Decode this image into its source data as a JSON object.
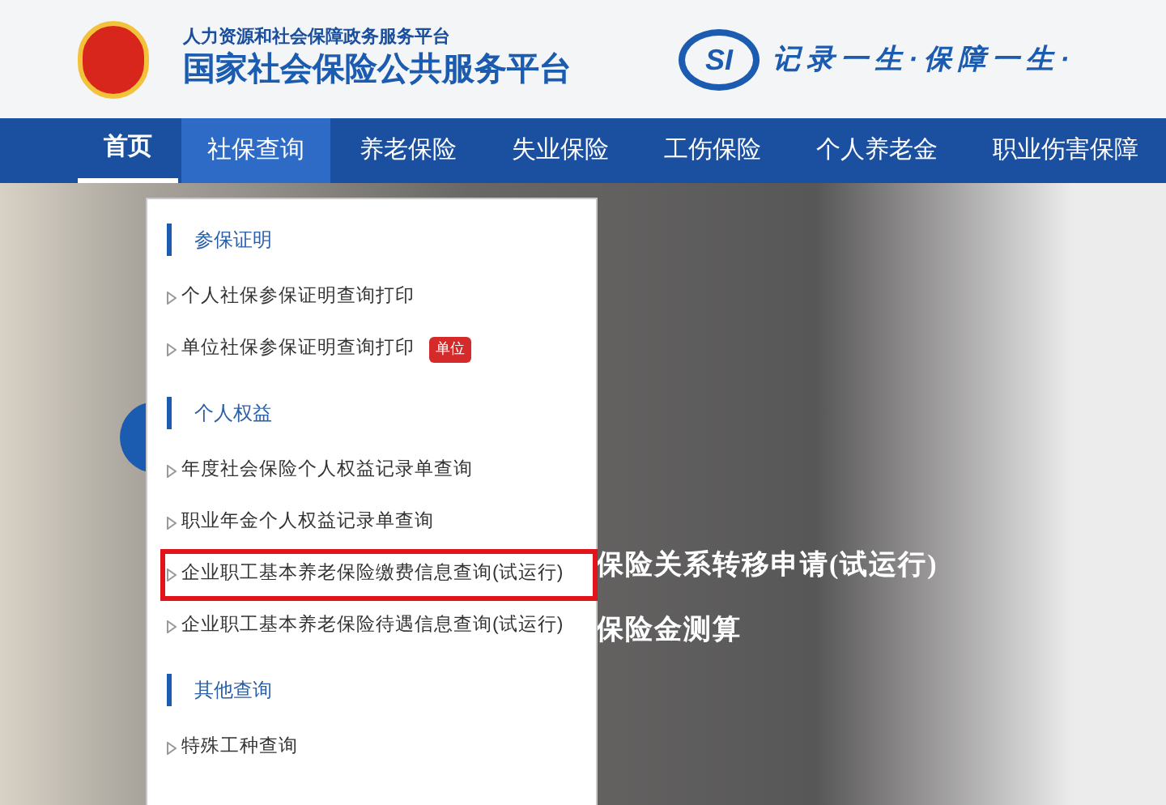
{
  "header": {
    "subtitle": "人力资源和社会保障政务服务平台",
    "title": "国家社会保险公共服务平台",
    "logo_text": "SI",
    "slogan": "记录一生·保障一生·"
  },
  "nav": [
    {
      "label": "首页",
      "current": true,
      "selected": false
    },
    {
      "label": "社保查询",
      "current": false,
      "selected": true
    },
    {
      "label": "养老保险",
      "current": false,
      "selected": false
    },
    {
      "label": "失业保险",
      "current": false,
      "selected": false
    },
    {
      "label": "工伤保险",
      "current": false,
      "selected": false
    },
    {
      "label": "个人养老金",
      "current": false,
      "selected": false
    },
    {
      "label": "职业伤害保障",
      "current": false,
      "selected": false
    }
  ],
  "dropdown": [
    {
      "title": "参保证明",
      "items": [
        {
          "label": "个人社保参保证明查询打印",
          "marked": false
        },
        {
          "label": "单位社保参保证明查询打印",
          "badge": "单位",
          "marked": false
        }
      ]
    },
    {
      "title": "个人权益",
      "items": [
        {
          "label": "年度社会保险个人权益记录单查询",
          "marked": false
        },
        {
          "label": "职业年金个人权益记录单查询",
          "marked": false
        },
        {
          "label": "企业职工基本养老保险缴费信息查询(试运行)",
          "marked": true
        },
        {
          "label": "企业职工基本养老保险待遇信息查询(试运行)",
          "marked": false
        }
      ]
    },
    {
      "title": "其他查询",
      "items": [
        {
          "label": "特殊工种查询",
          "marked": false
        }
      ]
    }
  ],
  "hero": {
    "lines": [
      "保险关系转移申请(试运行)",
      "保险金测算"
    ]
  }
}
